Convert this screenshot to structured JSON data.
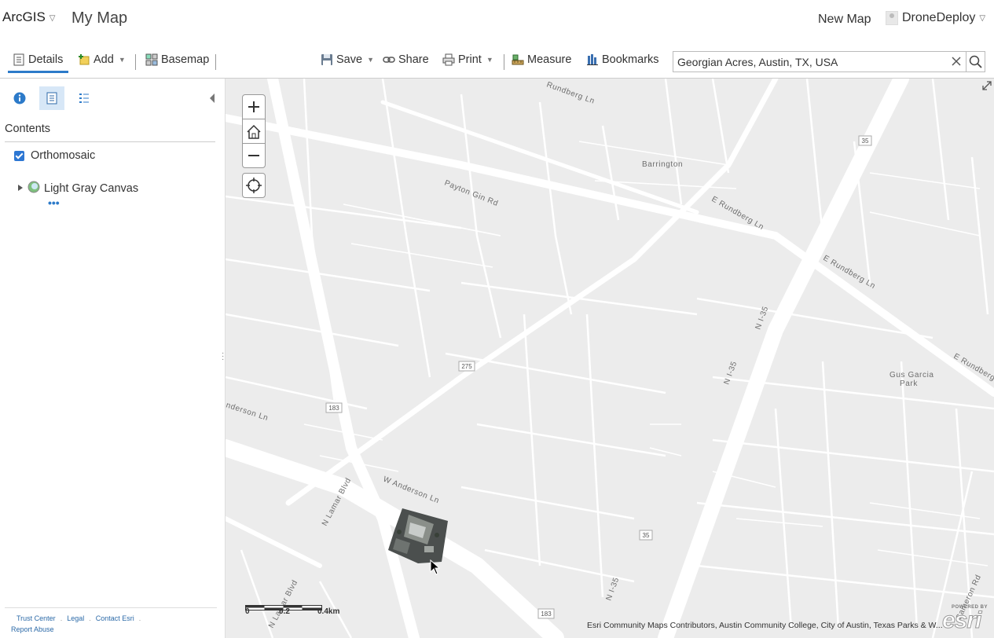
{
  "app": {
    "brand_label": "ArcGIS",
    "map_title": "My Map",
    "new_map_label": "New Map",
    "user_name": "DroneDeploy"
  },
  "toolbar": {
    "details_label": "Details",
    "add_label": "Add",
    "basemap_label": "Basemap",
    "save_label": "Save",
    "share_label": "Share",
    "print_label": "Print",
    "measure_label": "Measure",
    "bookmarks_label": "Bookmarks",
    "search_value": "Georgian Acres, Austin, TX, USA",
    "active_tab_color": "#2c7ac9"
  },
  "panel": {
    "contents_heading": "Contents",
    "layers": [
      {
        "name": "Orthomosaic",
        "checked": true
      },
      {
        "name": "Light Gray Canvas",
        "expandable": true
      }
    ],
    "layer_options_glyph": "•••",
    "footer_links": [
      "Trust Center",
      "Legal",
      "Contact Esri",
      "Report Abuse"
    ]
  },
  "map": {
    "labels": {
      "rundberg_top": "Rundberg Ln",
      "payton_gin": "Payton Gin Rd",
      "barrington": "Barrington",
      "e_rundberg_1": "E Rundberg Ln",
      "e_rundberg_2": "E Rundberg Ln",
      "e_rundberg_3": "E Rundberg",
      "ni35_a": "N I-35",
      "ni35_b": "N I-35",
      "ni35_c": "N I-35",
      "gus_garcia": "Gus Garcia",
      "gus_garcia_2": "Park",
      "anderson_w": "nderson Ln",
      "w_anderson": "W Anderson Ln",
      "n_lamar": "N Lamar Blvd",
      "n_lamar_2": "N Lamar Blvd",
      "cameron": "Cameron Rd"
    },
    "route_badges": [
      "35",
      "275",
      "183",
      "35",
      "183"
    ],
    "scale_labels": [
      "0",
      "0.2",
      "0.4km"
    ],
    "attribution": "Esri Community Maps Contributors, Austin Community College, City of Austin, Texas Parks & W...",
    "logo_powered": "POWERED BY",
    "logo_text": "esri",
    "land_color": "#ececec",
    "road_color": "#ffffff"
  }
}
